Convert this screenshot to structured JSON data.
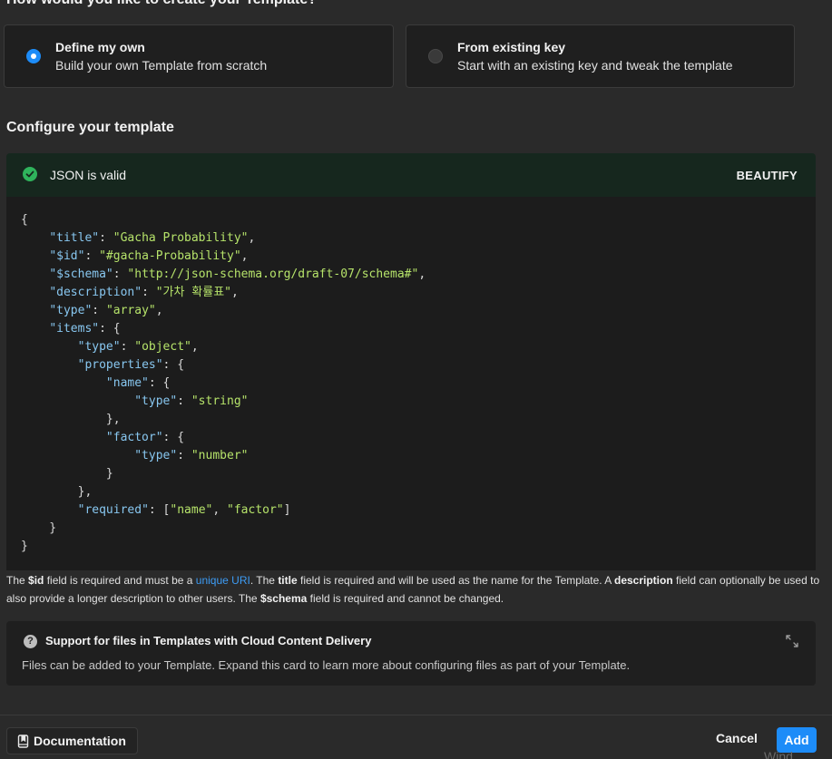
{
  "page": {
    "heading": "How would you like to create your Template?"
  },
  "options": [
    {
      "title": "Define my own",
      "subtitle": "Build your own Template from scratch",
      "selected": true
    },
    {
      "title": "From existing key",
      "subtitle": "Start with an existing key and tweak the template",
      "selected": false
    }
  ],
  "configure": {
    "title": "Configure your template",
    "status": "JSON is valid",
    "beautify_label": "BEAUTIFY",
    "status_color": "#2fb35c"
  },
  "editor": {
    "lines": [
      "{",
      "    \"title\": \"Gacha Probability\",",
      "    \"$id\": \"#gacha-Probability\",",
      "    \"$schema\": \"http://json-schema.org/draft-07/schema#\",",
      "    \"description\": \"가차 확률표\",",
      "    \"type\": \"array\",",
      "    \"items\": {",
      "        \"type\": \"object\",",
      "        \"properties\": {",
      "            \"name\": {",
      "                \"type\": \"string\"",
      "            },",
      "            \"factor\": {",
      "                \"type\": \"number\"",
      "            }",
      "        },",
      "        \"required\": [\"name\", \"factor\"]",
      "    }",
      "}"
    ]
  },
  "help": {
    "p1": "The ",
    "id_field": "$id",
    "p2": " field is required and must be a ",
    "link": "unique URI",
    "p3": ". The ",
    "title_field": "title",
    "p4": " field is required and will be used as the name for the Template. A ",
    "description_field": "description",
    "p5": " field can optionally be used to also provide a longer description to other users. The ",
    "schema_field": "$schema",
    "p6": " field is required and cannot be changed."
  },
  "support": {
    "title": "Support for files in Templates with Cloud Content Delivery",
    "description": "Files can be added to your Template. Expand this card to learn more about configuring files as part of your Template.",
    "icon": "help-icon"
  },
  "footer": {
    "documentation_label": "Documentation",
    "cancel_label": "Cancel",
    "add_label": "Add",
    "watermark": "Wind"
  },
  "colors": {
    "accent": "#1d8cf8",
    "json_key": "#88c7f0",
    "json_string": "#b6e36a",
    "link": "#3d9cf5"
  }
}
